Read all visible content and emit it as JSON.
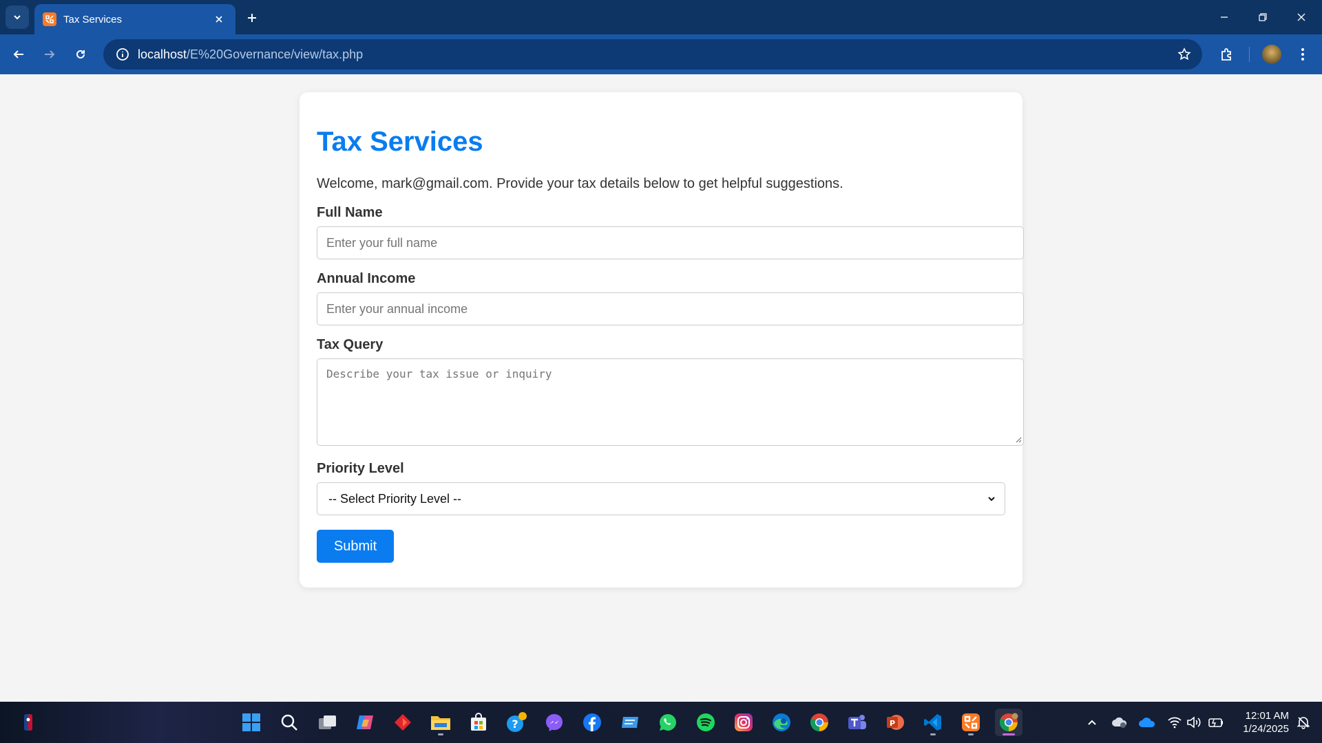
{
  "browser": {
    "tab_title": "Tax Services",
    "url_host": "localhost",
    "url_path": "/E%20Governance/view/tax.php"
  },
  "page": {
    "title": "Tax Services",
    "welcome": "Welcome, mark@gmail.com. Provide your tax details below to get helpful suggestions.",
    "full_name_label": "Full Name",
    "full_name_placeholder": "Enter your full name",
    "income_label": "Annual Income",
    "income_placeholder": "Enter your annual income",
    "query_label": "Tax Query",
    "query_placeholder": "Describe your tax issue or inquiry",
    "priority_label": "Priority Level",
    "priority_selected": "-- Select Priority Level --",
    "submit_label": "Submit"
  },
  "colors": {
    "accent": "#0a7cf0",
    "chrome_toolbar": "#1a56a6",
    "chrome_tabstrip": "#0e3463"
  },
  "taskbar": {
    "icons": [
      "nba-icon",
      "start-icon",
      "search-icon",
      "task-view-icon",
      "copilot-icon",
      "app-red-icon",
      "file-explorer-icon",
      "store-icon",
      "help-icon",
      "messenger-icon",
      "facebook-icon",
      "app-blue-icon",
      "whatsapp-icon",
      "spotify-icon",
      "instagram-icon",
      "edge-icon",
      "chrome-icon",
      "teams-icon",
      "powerpoint-icon",
      "vscode-icon",
      "xampp-icon",
      "chrome-profile-icon"
    ],
    "time": "12:01 AM",
    "date": "1/24/2025"
  }
}
